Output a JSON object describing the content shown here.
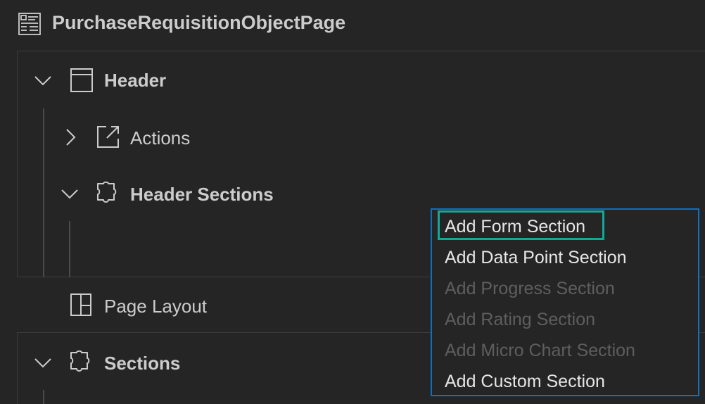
{
  "title": "PurchaseRequisitionObjectPage",
  "tree": {
    "header": {
      "label": "Header",
      "expanded": true
    },
    "actions": {
      "label": "Actions",
      "expanded": false
    },
    "header_sections": {
      "label": "Header Sections",
      "expanded": true
    },
    "page_layout": {
      "label": "Page Layout"
    },
    "sections": {
      "label": "Sections",
      "expanded": true
    }
  },
  "context_menu": {
    "items": [
      {
        "label": "Add Form Section",
        "enabled": true,
        "focused": true
      },
      {
        "label": "Add Data Point Section",
        "enabled": true
      },
      {
        "label": "Add Progress Section",
        "enabled": false
      },
      {
        "label": "Add Rating Section",
        "enabled": false
      },
      {
        "label": "Add Micro Chart Section",
        "enabled": false
      },
      {
        "label": "Add Custom Section",
        "enabled": true
      }
    ]
  },
  "icons": {
    "title": "page-form-icon",
    "header": "panel-icon",
    "actions": "external-link-icon",
    "header_sections": "puzzle-icon",
    "page_layout": "layout-icon",
    "sections": "puzzle-icon"
  },
  "colors": {
    "background": "#252526",
    "text": "#cccccc",
    "menu_border": "#0e70c0",
    "focus_ring": "#14a89b",
    "disabled_text": "#5e5e5e"
  }
}
